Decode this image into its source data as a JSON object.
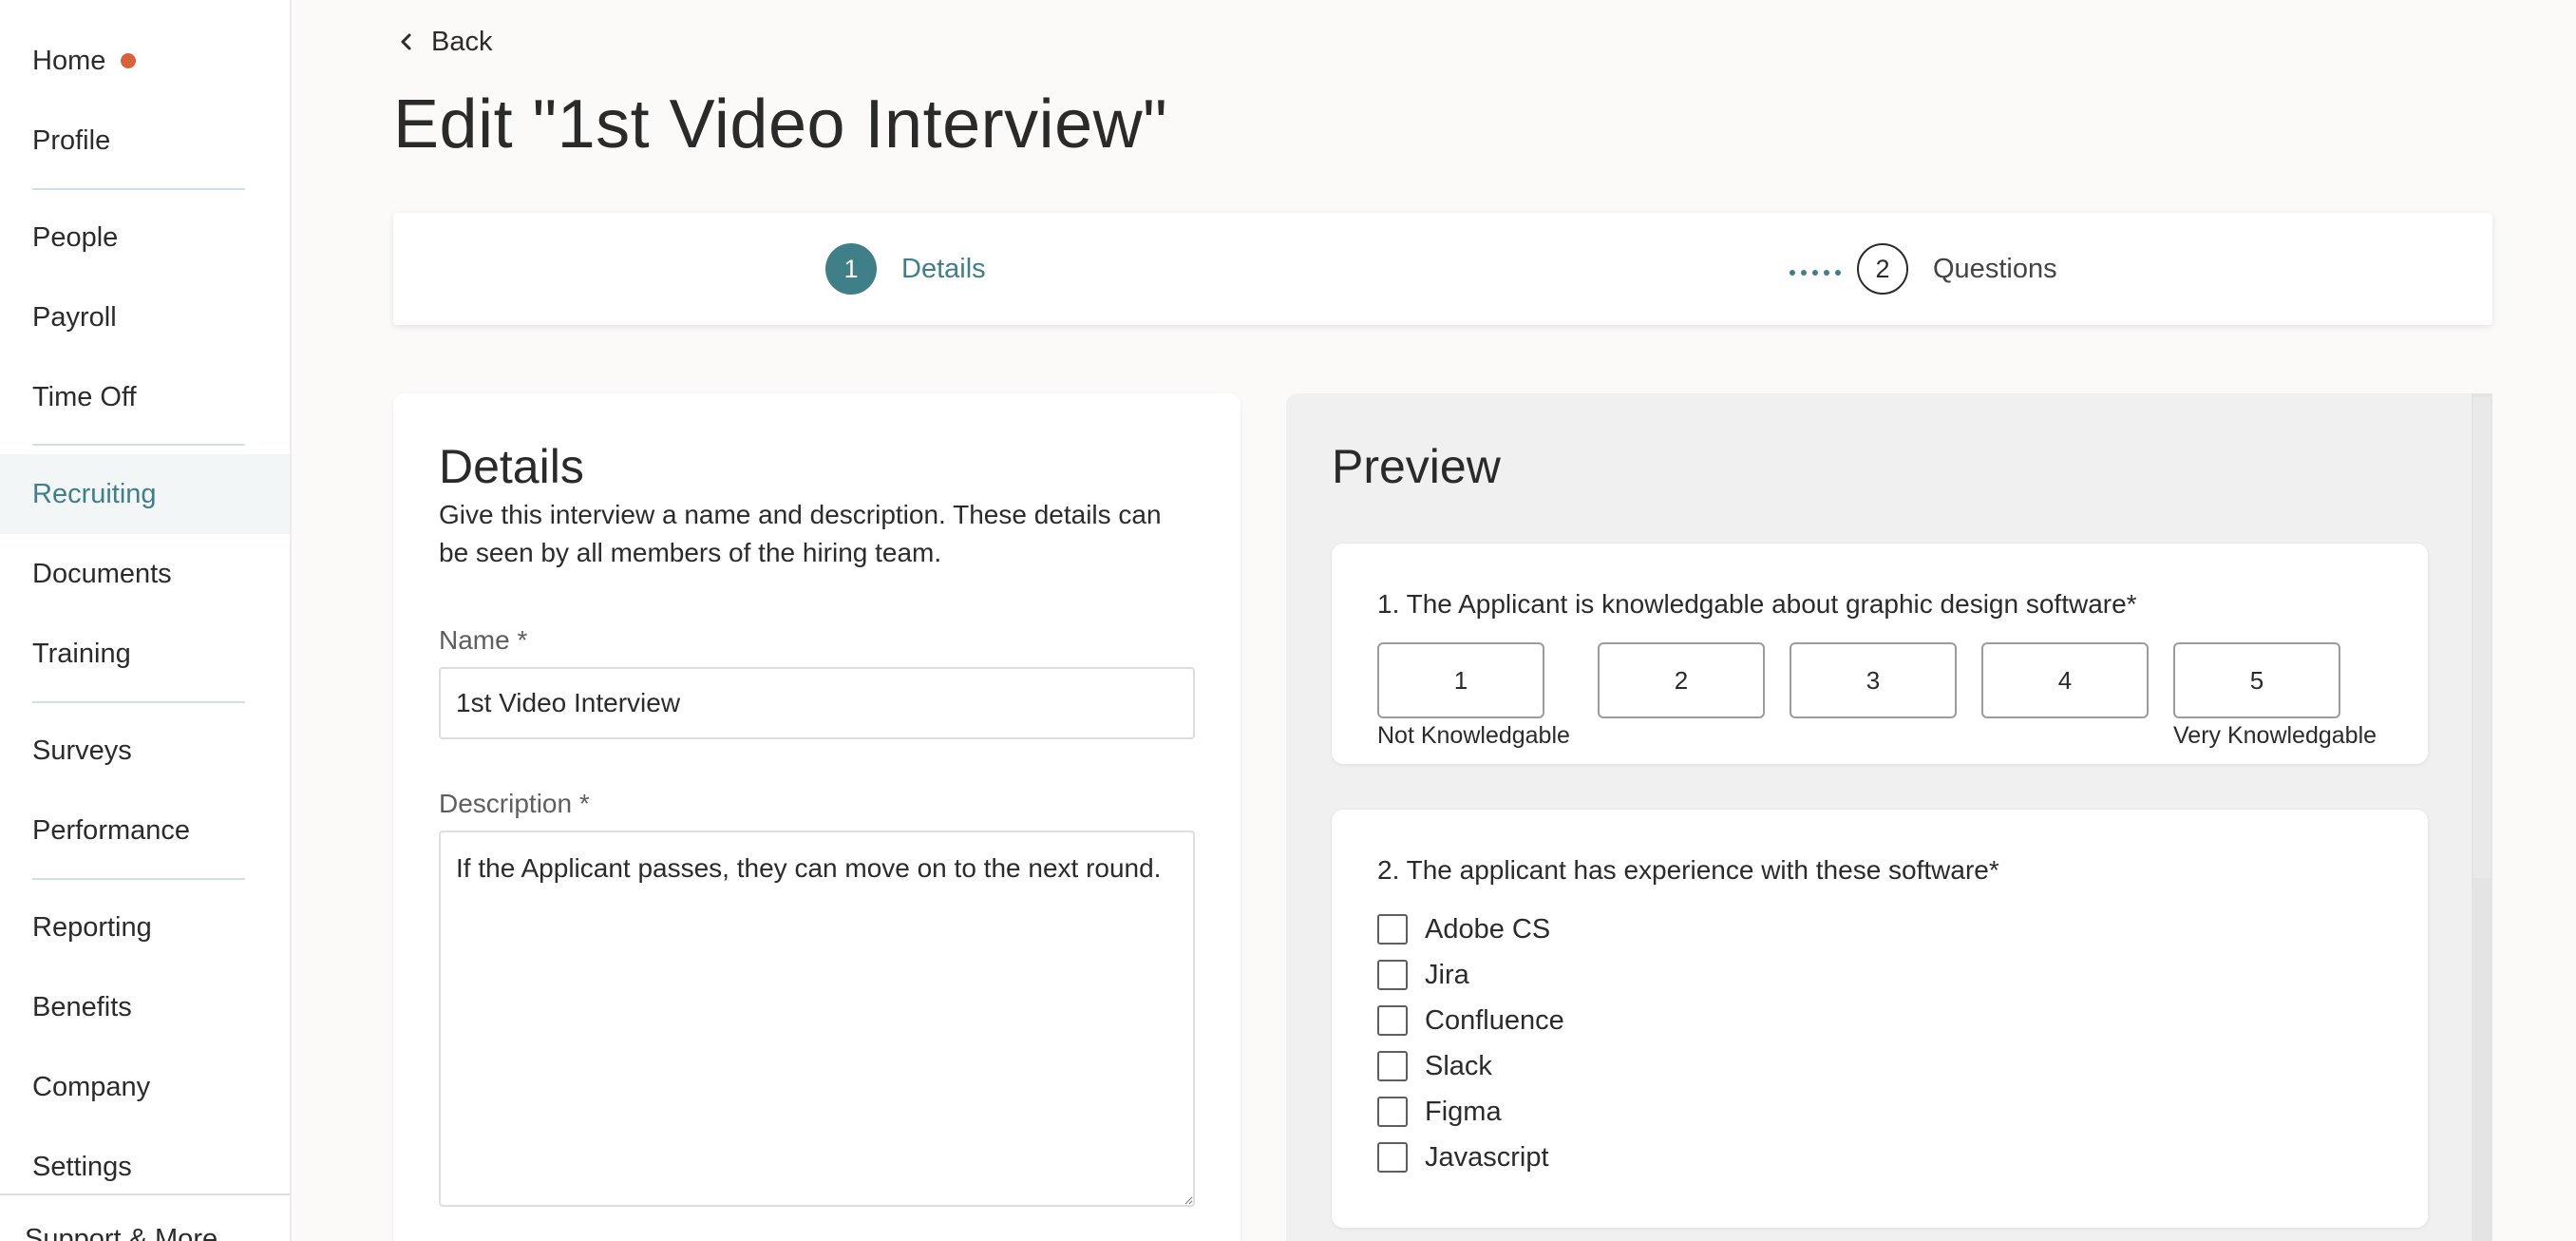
{
  "sidebar": {
    "items": [
      {
        "label": "Home",
        "badge": true
      },
      {
        "label": "Profile"
      },
      {
        "label": "People"
      },
      {
        "label": "Payroll"
      },
      {
        "label": "Time Off"
      },
      {
        "label": "Recruiting",
        "active": true
      },
      {
        "label": "Documents"
      },
      {
        "label": "Training"
      },
      {
        "label": "Surveys"
      },
      {
        "label": "Performance"
      },
      {
        "label": "Reporting"
      },
      {
        "label": "Benefits"
      },
      {
        "label": "Company"
      },
      {
        "label": "Settings"
      }
    ],
    "support_label": "Support & More"
  },
  "header": {
    "back_label": "Back",
    "title": "Edit \"1st Video Interview\""
  },
  "stepper": {
    "steps": [
      {
        "number": "1",
        "label": "Details",
        "state": "active"
      },
      {
        "number": "2",
        "label": "Questions",
        "state": "inactive"
      }
    ]
  },
  "details": {
    "title": "Details",
    "description": "Give this interview a name and description. These details can be seen by all members of the hiring team.",
    "name_label": "Name *",
    "name_value": "1st Video Interview",
    "description_label": "Description *",
    "description_value": "If the Applicant passes, they can move on to the next round."
  },
  "preview": {
    "title": "Preview",
    "questions": [
      {
        "text": "1. The Applicant is knowledgable about graphic design software*",
        "scale": [
          "1",
          "2",
          "3",
          "4",
          "5"
        ],
        "min_label": "Not Knowledgable",
        "max_label": "Very Knowledgable"
      },
      {
        "text": "2. The applicant has experience with these software*",
        "options": [
          "Adobe CS",
          "Jira",
          "Confluence",
          "Slack",
          "Figma",
          "Javascript"
        ]
      }
    ]
  },
  "colors": {
    "accent": "#3e7f88",
    "badge": "#d8633b",
    "background": "#fbfaf9"
  }
}
